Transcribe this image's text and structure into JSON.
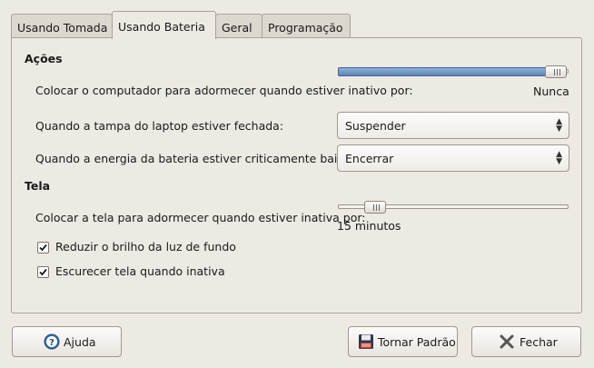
{
  "tabs": {
    "on_ac": "Usando Tomada",
    "on_battery": "Usando Bateria",
    "general": "Geral",
    "scheduling": "Programação"
  },
  "actions": {
    "heading": "Ações",
    "sleep_label": "Colocar o computador para adormecer quando estiver inativo por:",
    "sleep_value": "Nunca",
    "sleep_level": 1.0,
    "lid_label": "Quando a tampa do laptop estiver fechada:",
    "lid_value": "Suspender",
    "critical_label": "Quando a energia da bateria estiver criticamente baixa:",
    "critical_value": "Encerrar"
  },
  "display": {
    "heading": "Tela",
    "sleep_label": "Colocar a tela para adormecer quando estiver inativa por:",
    "sleep_value": "15 minutos",
    "sleep_level": 0.12,
    "reduce_backlight_label": "Reduzir o brilho da luz de fundo",
    "reduce_backlight_checked": true,
    "dim_label": "Escurecer tela quando inativa",
    "dim_checked": true
  },
  "buttons": {
    "help": "Ajuda",
    "make_default": "Tornar Padrão",
    "close": "Fechar"
  }
}
